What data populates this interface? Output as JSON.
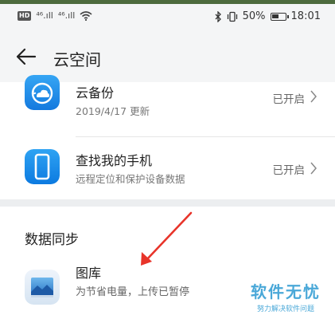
{
  "status_bar": {
    "hd_badge": "HD",
    "signal1": "⁴⁶.ıll",
    "signal2": "⁴⁶.ıll",
    "battery_percent": "50%",
    "battery_level": 0.5,
    "time": "18:01",
    "icons": [
      "hd-icon",
      "signal-icon",
      "signal-icon",
      "wifi-icon",
      "bluetooth-icon",
      "vibrate-icon",
      "battery-icon"
    ]
  },
  "header": {
    "back_icon": "arrow-left-icon",
    "title": "云空间"
  },
  "services": [
    {
      "title": "云备份",
      "subtitle": "2019/4/17 更新",
      "status": "已开启",
      "icon": "cloud-backup-icon"
    },
    {
      "title": "查找我的手机",
      "subtitle": "远程定位和保护设备数据",
      "status": "已开启",
      "icon": "find-phone-icon"
    }
  ],
  "sync": {
    "section_title": "数据同步",
    "items": [
      {
        "title": "图库",
        "subtitle": "为节省电量，上传已暂停",
        "icon": "gallery-icon"
      }
    ]
  },
  "watermark": {
    "main": "软件无忧",
    "sub": "努力解决软件问题"
  },
  "colors": {
    "accent_blue": "#1a8fe6",
    "arrow_red": "#e8342a",
    "watermark_blue": "#4aa8d8"
  }
}
